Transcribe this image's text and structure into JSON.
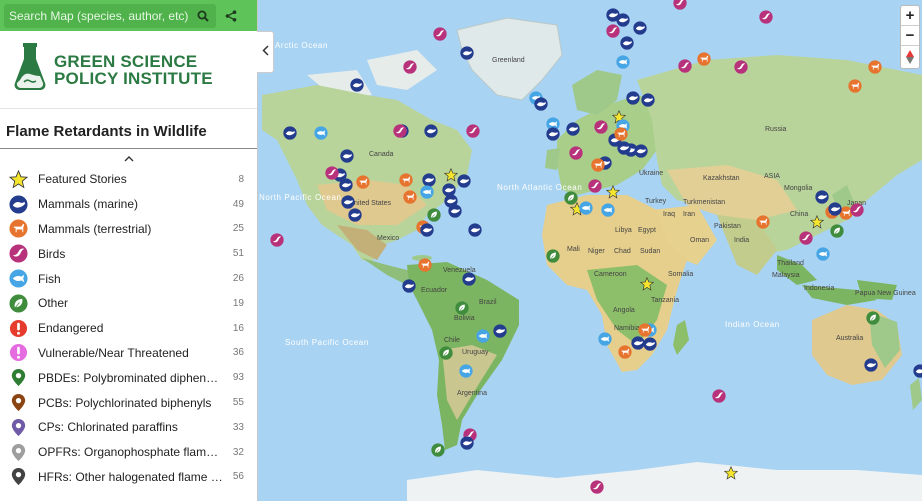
{
  "search": {
    "placeholder": "Search Map (species, author, etc)"
  },
  "logo": {
    "line1": "GREEN SCIENCE",
    "line2": "POLICY INSTITUTE"
  },
  "panel": {
    "title": "Flame Retardants in Wildlife"
  },
  "legend": [
    {
      "label": "Featured Stories",
      "count": "8",
      "icon": "star-icon",
      "color": "#f5e52e"
    },
    {
      "label": "Mammals (marine)",
      "count": "49",
      "icon": "whale-icon",
      "color": "#233c8e"
    },
    {
      "label": "Mammals (terrestrial)",
      "count": "25",
      "icon": "deer-icon",
      "color": "#e6732e"
    },
    {
      "label": "Birds",
      "count": "51",
      "icon": "bird-icon",
      "color": "#b8327b"
    },
    {
      "label": "Fish",
      "count": "26",
      "icon": "fish-icon",
      "color": "#46a5e5"
    },
    {
      "label": "Other",
      "count": "19",
      "icon": "leaf-icon",
      "color": "#3f8c3d"
    },
    {
      "label": "Endangered",
      "count": "16",
      "icon": "exclamation-icon",
      "color": "#e53c2e"
    },
    {
      "label": "Vulnerable/Near Threatened",
      "count": "36",
      "icon": "exclamation-icon",
      "color": "#e56be0"
    },
    {
      "label": "PBDEs: Polybrominated diphenyl ethers",
      "count": "93",
      "icon": "map-pin-icon",
      "color": "#2d7d32"
    },
    {
      "label": "PCBs: Polychlorinated biphenyls",
      "count": "55",
      "icon": "map-pin-icon",
      "color": "#8b4513"
    },
    {
      "label": "CPs: Chlorinated paraffins",
      "count": "33",
      "icon": "map-pin-icon",
      "color": "#6e5aa6"
    },
    {
      "label": "OPFRs: Organophosphate flame retardants",
      "count": "32",
      "icon": "map-pin-icon",
      "color": "#9e9e9e"
    },
    {
      "label": "HFRs: Other halogenated flame retardants",
      "count": "56",
      "icon": "map-pin-icon",
      "color": "#424242"
    }
  ],
  "map": {
    "labels": {
      "greenland": "Greenland",
      "canada": "Canada",
      "united_states": "United States",
      "mexico": "Mexico",
      "venezuela": "Venezuela",
      "ecuador": "Ecuador",
      "brazil": "Brazil",
      "bolivia": "Bolivia",
      "chile": "Chile",
      "uruguay": "Uruguay",
      "ukraine": "Ukraine",
      "kazakhstan": "Kazakhstan",
      "russia": "Russia",
      "asia": "ASIA",
      "turkey": "Turkey",
      "turkmenistan": "Turkmenistan",
      "iraq": "Iraq",
      "iran": "Iran",
      "libya": "Libya",
      "egypt": "Egypt",
      "mali": "Mali",
      "niger": "Niger",
      "chad": "Chad",
      "sudan": "Sudan",
      "cameroon": "Cameroon",
      "somalia": "Somalia",
      "india": "India",
      "oman": "Oman",
      "thailand": "Thailand",
      "malaysia": "Malaysia",
      "indonesia": "Indonesia",
      "papua": "Papua New Guinea",
      "australia": "Australia",
      "mongolia": "Mongolia",
      "china": "China",
      "japan": "Japan",
      "tanzania": "Tanzania",
      "angola": "Angola",
      "namibia": "Namibia",
      "pakistan": "Pakistan",
      "argentina": "Argentina",
      "north_atlantic": "North Atlantic Ocean",
      "north_pacific": "North Pacific Ocean",
      "south_pacific": "South Pacific Ocean",
      "indian_ocean": "Indian Ocean",
      "arctic": "Arctic Ocean"
    }
  }
}
